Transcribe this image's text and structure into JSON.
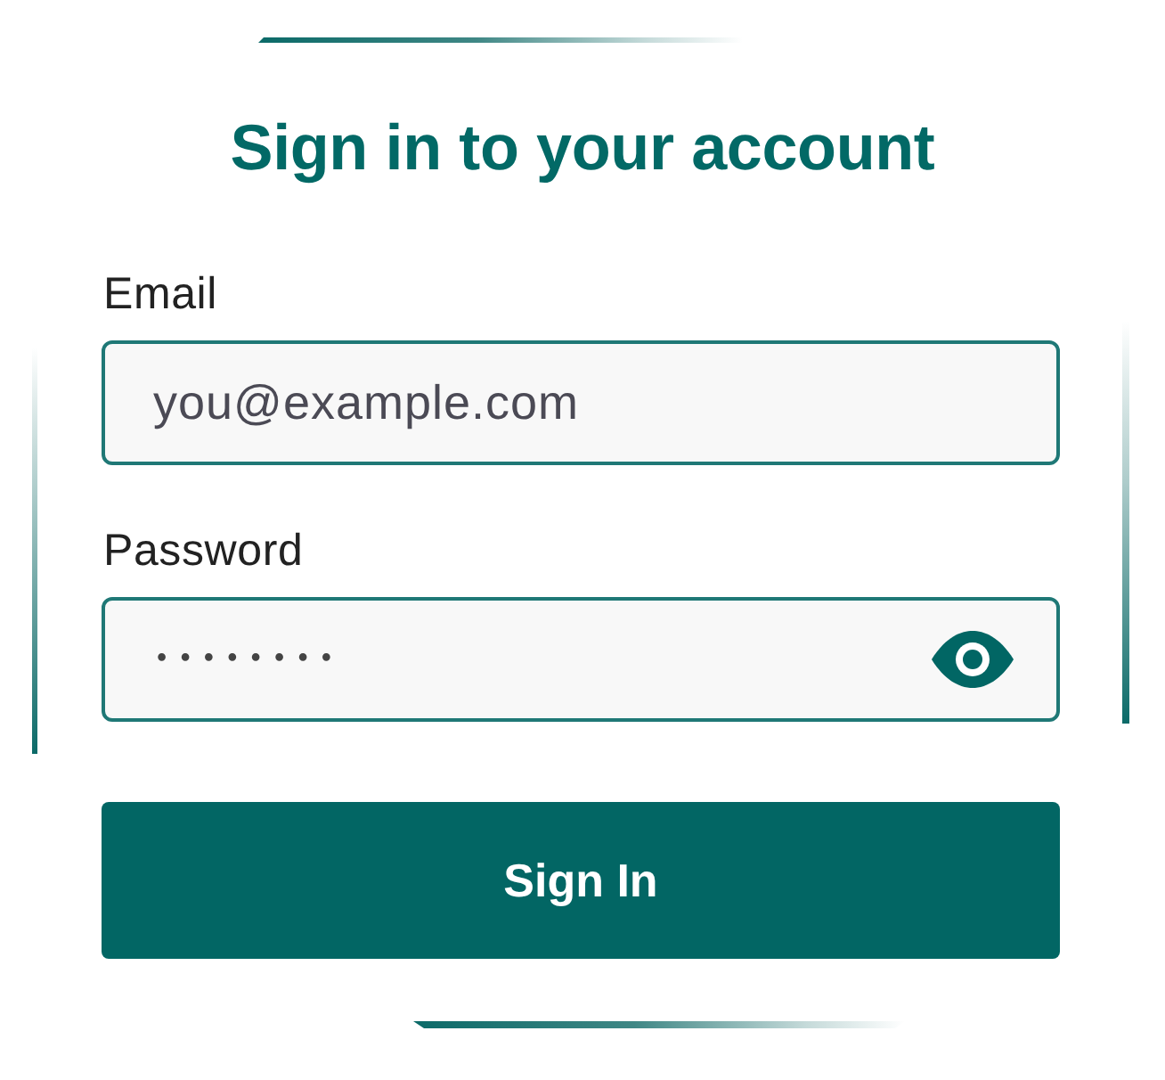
{
  "title": "Sign in to your account",
  "fields": [
    {
      "kind": "email",
      "label": "Email",
      "placeholder": "you@example.com"
    },
    {
      "kind": "password",
      "label": "Password",
      "value": "••••••••"
    }
  ],
  "submit_button": {
    "label": "Sign In"
  }
}
